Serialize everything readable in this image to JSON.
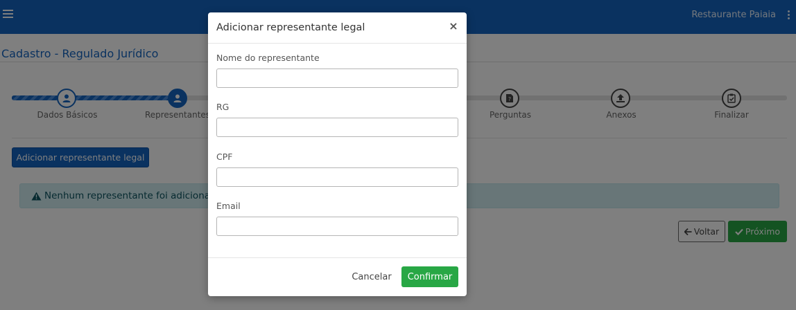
{
  "header": {
    "user_name": "Restaurante Paiaia",
    "menu_icon": "hamburger-icon",
    "options_icon": "kebab-icon",
    "color": "#1565c0"
  },
  "page": {
    "title": "Cadastro - Regulado Jurídico"
  },
  "stepper": {
    "steps": [
      {
        "label": "Dados Básicos",
        "icon": "user-icon",
        "state": "done"
      },
      {
        "label": "Representantes",
        "icon": "user-icon",
        "state": "current"
      },
      {
        "label": "",
        "icon": "",
        "state": "pending"
      },
      {
        "label": "Perguntas",
        "icon": "document-question-icon",
        "state": "pending"
      },
      {
        "label": "Anexos",
        "icon": "upload-icon",
        "state": "pending"
      },
      {
        "label": "Finalizar",
        "icon": "clipboard-check-icon",
        "state": "pending"
      }
    ]
  },
  "main": {
    "add_button_label": "Adicionar representante legal",
    "alert_text": "Nenhum representante foi adiciona",
    "alert_icon": "warning-icon",
    "back_label": "Voltar",
    "next_label": "Próximo"
  },
  "modal": {
    "title": "Adicionar representante legal",
    "close_label": "×",
    "fields": [
      {
        "label": "Nome do representante",
        "value": ""
      },
      {
        "label": "RG",
        "value": ""
      },
      {
        "label": "CPF",
        "value": ""
      },
      {
        "label": "Email",
        "value": ""
      }
    ],
    "cancel_label": "Cancelar",
    "confirm_label": "Confirmar"
  },
  "colors": {
    "primary": "#1565c0",
    "success": "#28a745",
    "info_bg": "#d1ecf1"
  }
}
